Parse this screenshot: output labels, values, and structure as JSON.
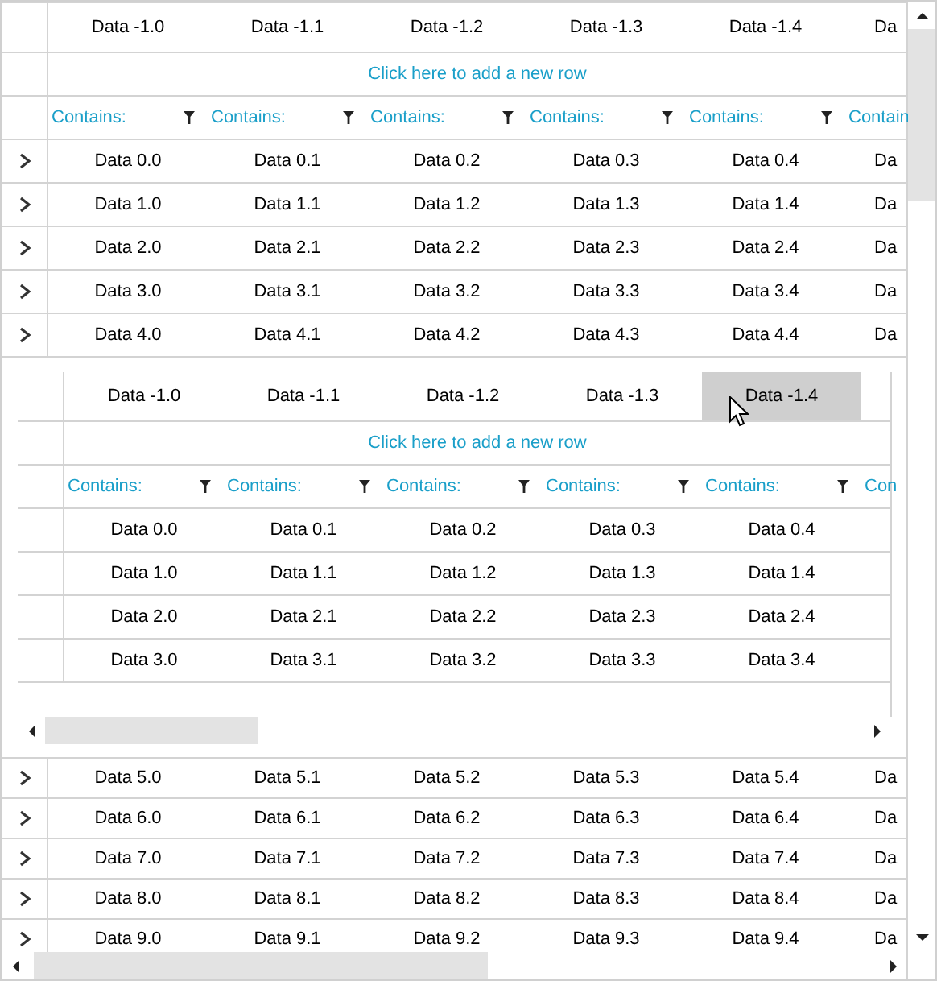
{
  "grid": {
    "header": [
      "Data -1.0",
      "Data -1.1",
      "Data -1.2",
      "Data -1.3",
      "Data -1.4",
      "Da"
    ],
    "new_row_prompt": "Click here to add a new row",
    "filters": [
      "Contains:",
      "Contains:",
      "Contains:",
      "Contains:",
      "Contains:",
      "Contain"
    ],
    "rows": [
      {
        "expanded": false,
        "cells": [
          "Data 0.0",
          "Data 0.1",
          "Data 0.2",
          "Data 0.3",
          "Data 0.4",
          "Da"
        ]
      },
      {
        "expanded": false,
        "cells": [
          "Data 1.0",
          "Data 1.1",
          "Data 1.2",
          "Data 1.3",
          "Data 1.4",
          "Da"
        ]
      },
      {
        "expanded": false,
        "cells": [
          "Data 2.0",
          "Data 2.1",
          "Data 2.2",
          "Data 2.3",
          "Data 2.4",
          "Da"
        ]
      },
      {
        "expanded": false,
        "cells": [
          "Data 3.0",
          "Data 3.1",
          "Data 3.2",
          "Data 3.3",
          "Data 3.4",
          "Da"
        ]
      },
      {
        "expanded": false,
        "cells": [
          "Data 4.0",
          "Data 4.1",
          "Data 4.2",
          "Data 4.3",
          "Data 4.4",
          "Da"
        ],
        "child_grid": {
          "header": [
            {
              "label": "Data -1.0",
              "hovered": false
            },
            {
              "label": "Data -1.1",
              "hovered": false
            },
            {
              "label": "Data -1.2",
              "hovered": false
            },
            {
              "label": "Data -1.3",
              "hovered": false
            },
            {
              "label": "Data -1.4",
              "hovered": true
            }
          ],
          "new_row_prompt": "Click here to add a new row",
          "filters": [
            "Contains:",
            "Contains:",
            "Contains:",
            "Contains:",
            "Contains:",
            "Con"
          ],
          "rows": [
            {
              "cells": [
                "Data 0.0",
                "Data 0.1",
                "Data 0.2",
                "Data 0.3",
                "Data 0.4"
              ]
            },
            {
              "cells": [
                "Data 1.0",
                "Data 1.1",
                "Data 1.2",
                "Data 1.3",
                "Data 1.4"
              ]
            },
            {
              "cells": [
                "Data 2.0",
                "Data 2.1",
                "Data 2.2",
                "Data 2.3",
                "Data 2.4"
              ]
            },
            {
              "cells": [
                "Data 3.0",
                "Data 3.1",
                "Data 3.2",
                "Data 3.3",
                "Data 3.4"
              ]
            }
          ]
        }
      },
      {
        "expanded": false,
        "cells": [
          "Data 5.0",
          "Data 5.1",
          "Data 5.2",
          "Data 5.3",
          "Data 5.4",
          "Da"
        ]
      },
      {
        "expanded": false,
        "cells": [
          "Data 6.0",
          "Data 6.1",
          "Data 6.2",
          "Data 6.3",
          "Data 6.4",
          "Da"
        ]
      },
      {
        "expanded": false,
        "cells": [
          "Data 7.0",
          "Data 7.1",
          "Data 7.2",
          "Data 7.3",
          "Data 7.4",
          "Da"
        ]
      },
      {
        "expanded": false,
        "cells": [
          "Data 8.0",
          "Data 8.1",
          "Data 8.2",
          "Data 8.3",
          "Data 8.4",
          "Da"
        ]
      },
      {
        "expanded": false,
        "cells": [
          "Data 9.0",
          "Data 9.1",
          "Data 9.2",
          "Data 9.3",
          "Data 9.4",
          "Da"
        ]
      }
    ]
  }
}
